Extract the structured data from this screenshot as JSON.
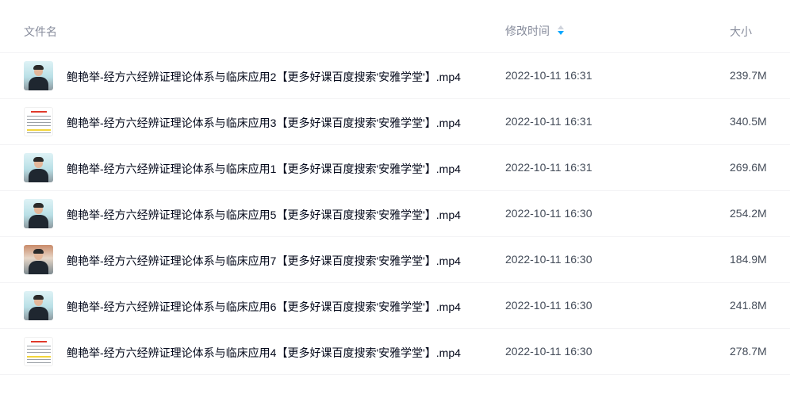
{
  "table": {
    "columns": {
      "name": "文件名",
      "modified": "修改时间",
      "size": "大小"
    },
    "sort": {
      "column": "modified",
      "direction": "descending",
      "icon": "sort-caret-icon",
      "active_color": "#06a7ff"
    },
    "rows": [
      {
        "thumbnail": "video",
        "name": "鲍艳举-经方六经辨证理论体系与临床应用2【更多好课百度搜索'安雅学堂'】.mp4",
        "modified": "2022-10-11 16:31",
        "size": "239.7M"
      },
      {
        "thumbnail": "document",
        "name": "鲍艳举-经方六经辨证理论体系与临床应用3【更多好课百度搜索'安雅学堂'】.mp4",
        "modified": "2022-10-11 16:31",
        "size": "340.5M"
      },
      {
        "thumbnail": "video",
        "name": "鲍艳举-经方六经辨证理论体系与临床应用1【更多好课百度搜索'安雅学堂'】.mp4",
        "modified": "2022-10-11 16:31",
        "size": "269.6M"
      },
      {
        "thumbnail": "video",
        "name": "鲍艳举-经方六经辨证理论体系与临床应用5【更多好课百度搜索'安雅学堂'】.mp4",
        "modified": "2022-10-11 16:30",
        "size": "254.2M"
      },
      {
        "thumbnail": "video",
        "name": "鲍艳举-经方六经辨证理论体系与临床应用7【更多好课百度搜索'安雅学堂'】.mp4",
        "modified": "2022-10-11 16:30",
        "size": "184.9M"
      },
      {
        "thumbnail": "video",
        "name": "鲍艳举-经方六经辨证理论体系与临床应用6【更多好课百度搜索'安雅学堂'】.mp4",
        "modified": "2022-10-11 16:30",
        "size": "241.8M"
      },
      {
        "thumbnail": "document",
        "name": "鲍艳举-经方六经辨证理论体系与临床应用4【更多好课百度搜索'安雅学堂'】.mp4",
        "modified": "2022-10-11 16:30",
        "size": "278.7M"
      }
    ]
  }
}
